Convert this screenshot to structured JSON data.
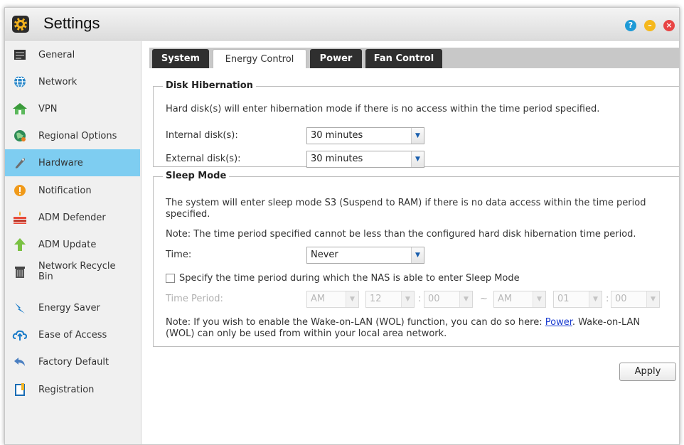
{
  "window": {
    "title": "Settings",
    "help_glyph": "?",
    "minimize_glyph": "–",
    "close_glyph": "×"
  },
  "sidebar": {
    "items": [
      {
        "label": "General",
        "icon": "general-icon"
      },
      {
        "label": "Network",
        "icon": "globe-icon"
      },
      {
        "label": "VPN",
        "icon": "vpn-icon"
      },
      {
        "label": "Regional Options",
        "icon": "regional-icon"
      },
      {
        "label": "Hardware",
        "icon": "hardware-icon",
        "active": true
      },
      {
        "label": "Notification",
        "icon": "alert-icon"
      },
      {
        "label": "ADM Defender",
        "icon": "firewall-icon"
      },
      {
        "label": "ADM Update",
        "icon": "update-arrow-icon"
      },
      {
        "label": "Network Recycle Bin",
        "icon": "trash-icon"
      },
      {
        "label": "Energy Saver",
        "icon": "energy-icon"
      },
      {
        "label": "Ease of Access",
        "icon": "cloud-upload-icon"
      },
      {
        "label": "Factory Default",
        "icon": "undo-icon"
      },
      {
        "label": "Registration",
        "icon": "registration-icon"
      }
    ]
  },
  "tabs": {
    "system": "System",
    "energy_control": "Energy Control",
    "power": "Power",
    "fan_control": "Fan Control",
    "active": "Energy Control"
  },
  "disk_hibernation": {
    "legend": "Disk Hibernation",
    "description": "Hard disk(s) will enter hibernation mode if there is no access within the time period specified.",
    "internal_label": "Internal disk(s):",
    "internal_value": "30 minutes",
    "external_label": "External disk(s):",
    "external_value": "30 minutes"
  },
  "sleep_mode": {
    "legend": "Sleep Mode",
    "description_line1": "The system will enter sleep mode S3 (Suspend to RAM) if there is no data access within the time period",
    "description_line2": "specified.",
    "note": "Note: The time period specified cannot be less than the configured hard disk hibernation time period.",
    "time_label": "Time:",
    "time_value": "Never",
    "specify_label": "Specify the time period during which the NAS is able to enter Sleep Mode",
    "specify_checked": false,
    "time_period_label": "Time Period:",
    "start_ampm": "AM",
    "start_hour": "12",
    "start_minute": "00",
    "colon": ":",
    "range_sep": "~",
    "end_ampm": "AM",
    "end_hour": "01",
    "end_minute": "00",
    "wol_note_prefix": "Note: If you wish to enable the Wake-on-LAN (WOL) function, you can do so here: ",
    "wol_link": "Power",
    "wol_note_suffix": ". Wake-on-LAN",
    "wol_note_line2": "(WOL) can only be used from within your local area network."
  },
  "buttons": {
    "apply": "Apply"
  },
  "colors": {
    "active_item": "#7ecdf1",
    "tab_dark": "#2f2f2f",
    "link": "#1a3cd0"
  }
}
